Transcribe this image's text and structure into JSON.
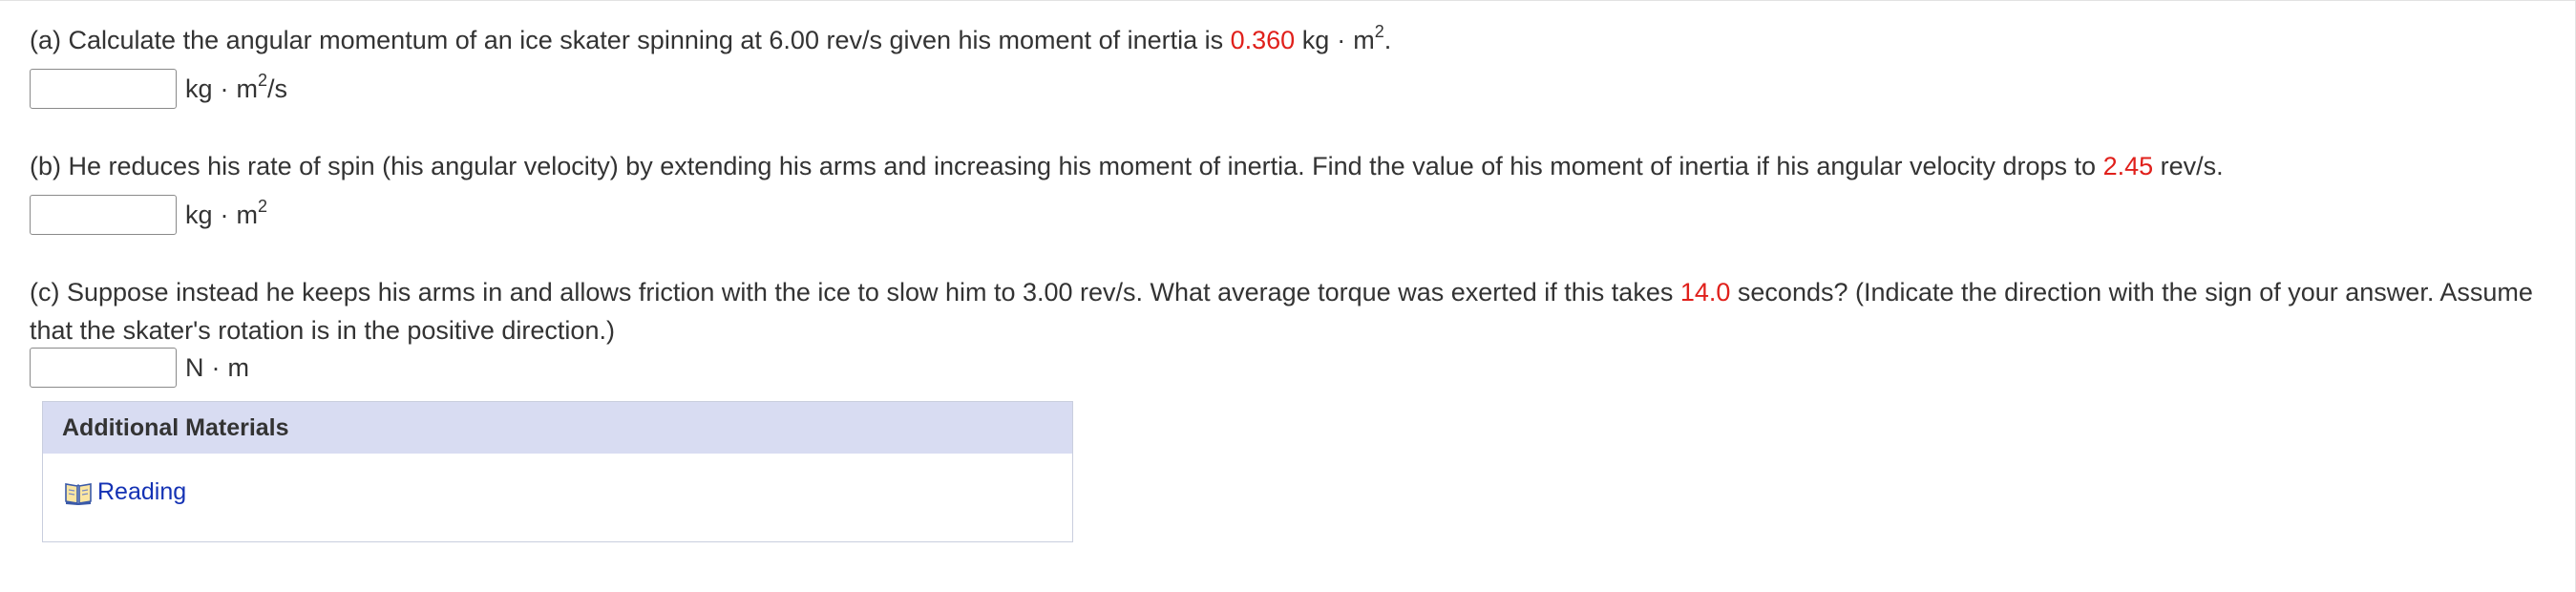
{
  "part_a": {
    "prefix": "(a) Calculate the angular momentum of an ice skater spinning at 6.00 rev/s given his moment of inertia is ",
    "value": "0.360",
    "unit_kg": "kg",
    "dot": "·",
    "unit_m": "m",
    "exponent": "2",
    "suffix": ".",
    "answer_value": "",
    "answer_unit_kg": "kg",
    "answer_unit_dot": "·",
    "answer_unit_m": "m",
    "answer_unit_exp": "2",
    "answer_unit_tail": "/s"
  },
  "part_b": {
    "prefix": "(b) He reduces his rate of spin (his angular velocity) by extending his arms and increasing his moment of inertia. Find the value of his moment of inertia if his angular velocity drops to ",
    "value": "2.45",
    "suffix": " rev/s.",
    "answer_value": "",
    "answer_unit_kg": "kg",
    "answer_unit_dot": "·",
    "answer_unit_m": "m",
    "answer_unit_exp": "2"
  },
  "part_c": {
    "prefix": "(c) Suppose instead he keeps his arms in and allows friction with the ice to slow him to 3.00 rev/s. What average torque was exerted if this takes ",
    "value": "14.0",
    "suffix": " seconds? (Indicate the direction with the sign of your answer. Assume that the skater's rotation is in the positive direction.)",
    "answer_value": "",
    "answer_unit_n": "N",
    "answer_unit_dot": "·",
    "answer_unit_m": "m"
  },
  "additional_materials": {
    "title": "Additional Materials",
    "reading_label": "Reading",
    "icon": "book-icon"
  },
  "colors": {
    "highlight_value": "#e0201b",
    "link": "#1432b4",
    "header_bg": "#d8dcf2"
  }
}
